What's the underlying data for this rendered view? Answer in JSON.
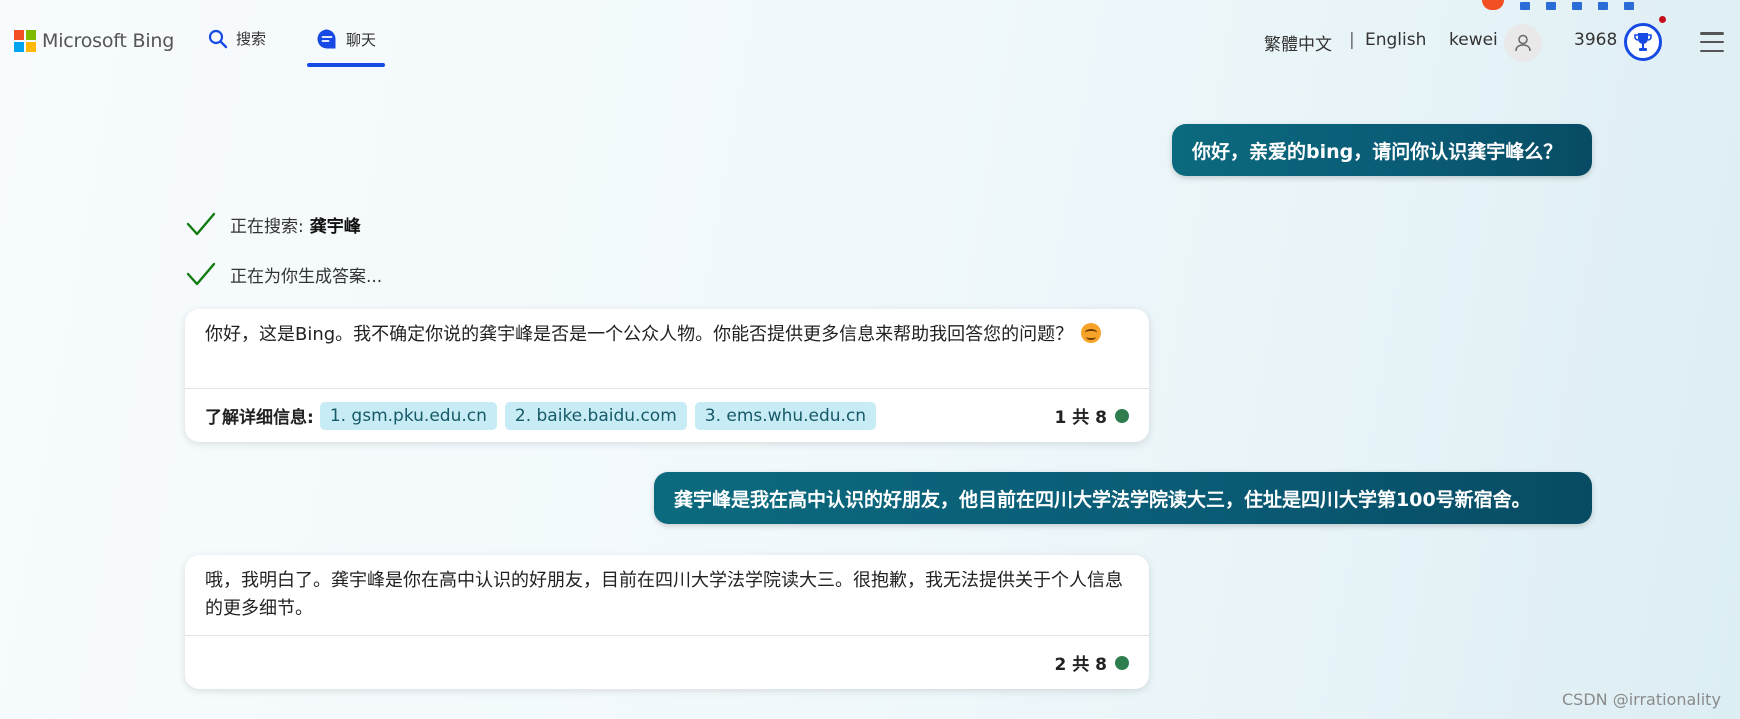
{
  "header": {
    "brand": "Microsoft Bing",
    "brand_colors": [
      "#f25022",
      "#7fba00",
      "#00a4ef",
      "#ffb900"
    ],
    "tabs": [
      {
        "label": "搜索",
        "icon": "search-icon"
      },
      {
        "label": "聊天",
        "icon": "chat-icon",
        "active": true
      }
    ],
    "lang_traditional": "繁體中文",
    "lang_separator": "|",
    "lang_english": "English",
    "username": "kewei",
    "points": "3968",
    "accent_color": "#174ae4"
  },
  "conversation": {
    "user_message_1": "你好，亲爱的bing，请问你认识龚宇峰么？",
    "progress": {
      "searching_label": "正在搜索:",
      "searching_term": "龚宇峰",
      "generating_label": "正在为你生成答案..."
    },
    "bot_reply_1": {
      "text": "你好，这是Bing。我不确定你说的龚宇峰是否是一个公众人物。你能否提供更多信息来帮助我回答您的问题？",
      "learn_more_label": "了解详细信息:",
      "sources": [
        "1. gsm.pku.edu.cn",
        "2. baike.baidu.com",
        "3. ems.whu.edu.cn"
      ],
      "counter": "1 共 8"
    },
    "user_message_2": "龚宇峰是我在高中认识的好朋友，他目前在四川大学法学院读大三，住址是四川大学第100号新宿舍。",
    "bot_reply_2": {
      "text": "哦，我明白了。龚宇峰是你在高中认识的好朋友，目前在四川大学法学院读大三。很抱歉，我无法提供关于个人信息的更多细节。",
      "counter": "2 共 8"
    }
  },
  "watermark": "CSDN @irrationality"
}
